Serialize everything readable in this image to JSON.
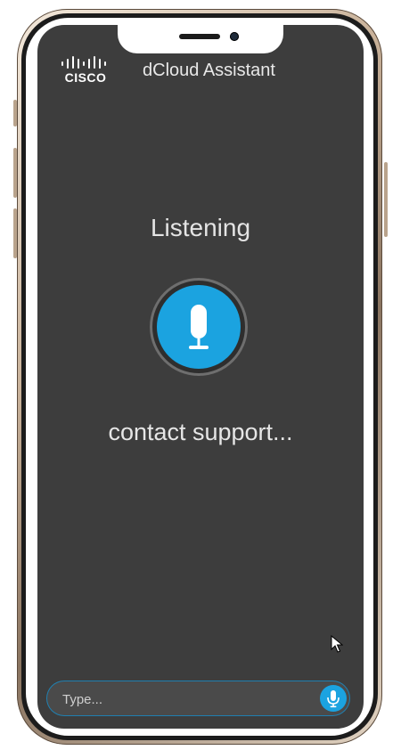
{
  "header": {
    "logo_text": "CISCO",
    "title": "dCloud Assistant"
  },
  "voice": {
    "status": "Listening",
    "transcript": "contact support..."
  },
  "input": {
    "placeholder": "Type..."
  },
  "icons": {
    "mic": "microphone-icon",
    "logo": "cisco-logo-icon",
    "cursor": "mouse-pointer-icon"
  },
  "colors": {
    "accent": "#1ba3e0",
    "screen_bg": "#3d3d3d",
    "text": "#e4e4e4"
  }
}
